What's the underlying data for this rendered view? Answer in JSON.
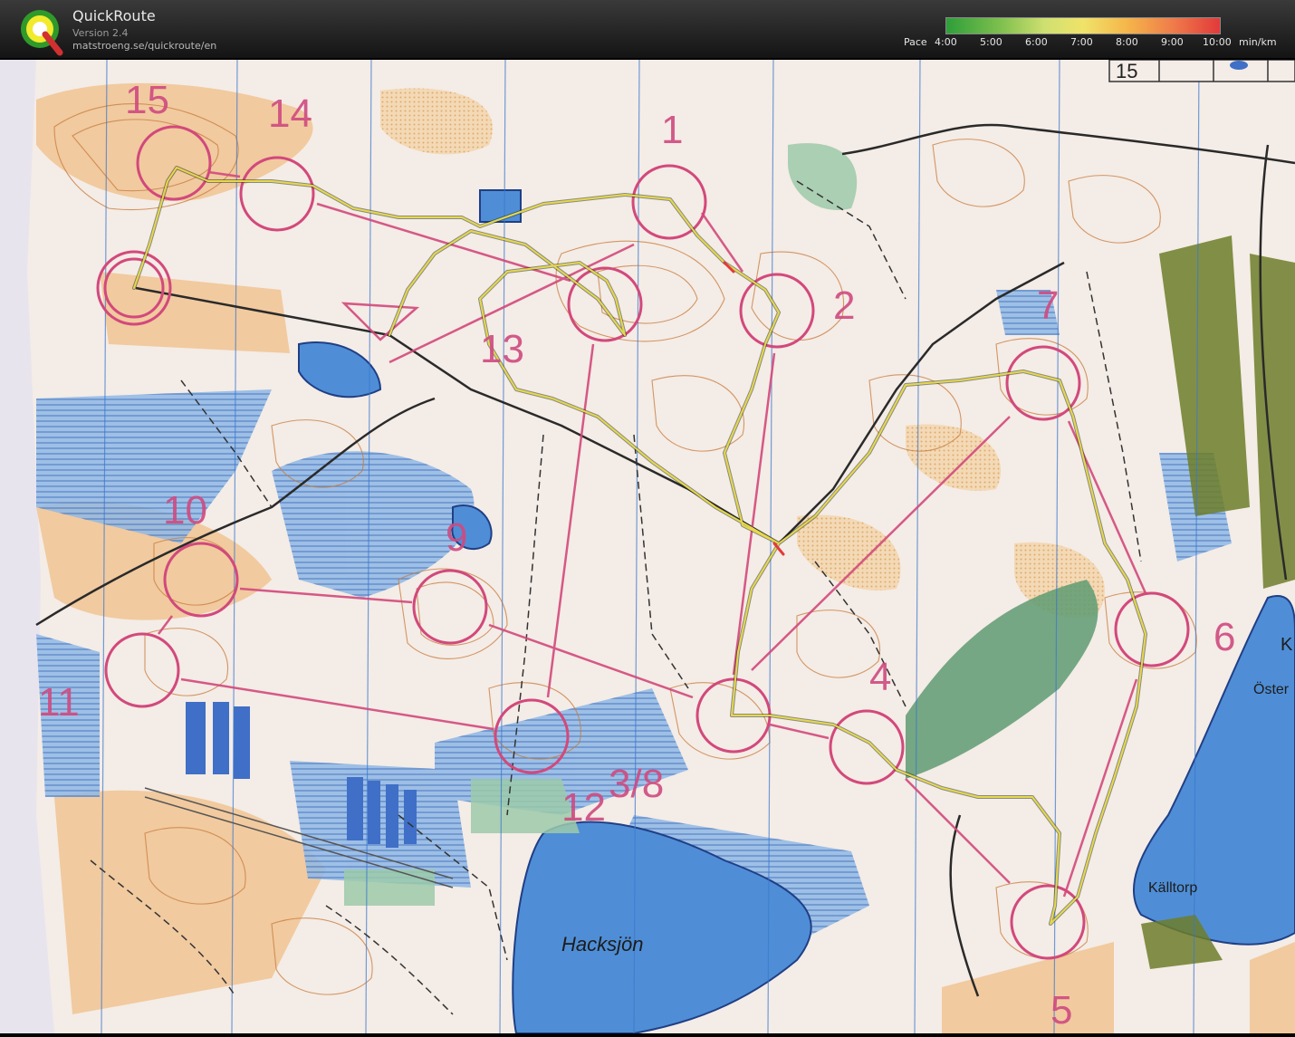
{
  "app": {
    "title": "QuickRoute",
    "version": "Version 2.4",
    "url": "matstroeng.se/quickroute/en"
  },
  "pace_scale": {
    "label": "Pace",
    "unit": "min/km",
    "ticks": [
      "4:00",
      "5:00",
      "6:00",
      "7:00",
      "8:00",
      "9:00",
      "10:00"
    ],
    "colors": [
      "#2e9e3a",
      "#7fc04e",
      "#cfe070",
      "#f0e36a",
      "#f5b64a",
      "#ef7b4a",
      "#e23a3a"
    ]
  },
  "map": {
    "colors": {
      "paper": "#f4ece6",
      "water": "#4f8ed6",
      "marsh": "#8fb8e6",
      "open_land": "#f0c89a",
      "green": "#5e9b72",
      "contour": "#c7793a",
      "course": "#d2497c",
      "route": "#e6d84a"
    },
    "place_labels": [
      "Hacksjön",
      "Källtorp",
      "Öster",
      "K"
    ],
    "sheet_label": "15",
    "controls": [
      {
        "label": "1"
      },
      {
        "label": "2"
      },
      {
        "label": "3/8"
      },
      {
        "label": "4"
      },
      {
        "label": "5"
      },
      {
        "label": "6"
      },
      {
        "label": "7"
      },
      {
        "label": "9"
      },
      {
        "label": "10"
      },
      {
        "label": "11"
      },
      {
        "label": "12"
      },
      {
        "label": "13"
      },
      {
        "label": "14"
      },
      {
        "label": "15"
      }
    ]
  }
}
